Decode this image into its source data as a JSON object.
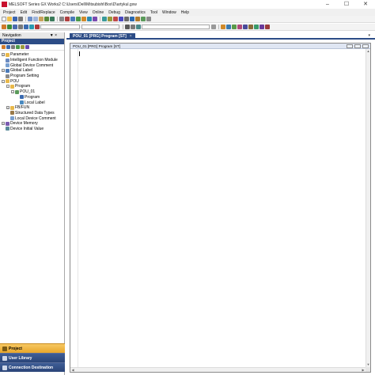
{
  "window": {
    "title": "MELSOFT Series GX Works2 C:\\Users\\Dell\\Mitsubishi\\Box\\D\\artykul.gxw",
    "minimize": "–",
    "maximize": "☐",
    "close": "✕"
  },
  "menu": [
    "Project",
    "Edit",
    "Find/Replace",
    "Compile",
    "View",
    "Online",
    "Debug",
    "Diagnostics",
    "Tool",
    "Window",
    "Help"
  ],
  "navigation": {
    "header": "Navigation",
    "pin": "▼ ×",
    "project_label": "Project",
    "tree": [
      {
        "label": "Parameter",
        "indent": 0,
        "expander": "+",
        "icon": "folder-icon"
      },
      {
        "label": "Intelligent Function Module",
        "indent": 0,
        "expander": "",
        "icon": "module-icon"
      },
      {
        "label": "Global Device Comment",
        "indent": 0,
        "expander": "",
        "icon": "comment-icon"
      },
      {
        "label": "Global Label",
        "indent": 0,
        "expander": "+",
        "icon": "label-icon"
      },
      {
        "label": "Program Setting",
        "indent": 0,
        "expander": "",
        "icon": "setting-icon"
      },
      {
        "label": "POU",
        "indent": 0,
        "expander": "−",
        "icon": "folder-icon"
      },
      {
        "label": "Program",
        "indent": 1,
        "expander": "−",
        "icon": "folder-icon"
      },
      {
        "label": "POU_01",
        "indent": 2,
        "expander": "−",
        "icon": "pou-icon"
      },
      {
        "label": "Program",
        "indent": 3,
        "expander": "",
        "icon": "program-icon"
      },
      {
        "label": "Local Label",
        "indent": 3,
        "expander": "",
        "icon": "local-label-icon"
      },
      {
        "label": "FB/FUN",
        "indent": 1,
        "expander": "+",
        "icon": "folder-icon"
      },
      {
        "label": "Structured Data Types",
        "indent": 1,
        "expander": "",
        "icon": "struct-icon"
      },
      {
        "label": "Local Device Comment",
        "indent": 1,
        "expander": "",
        "icon": "comment-icon"
      },
      {
        "label": "Device Memory",
        "indent": 0,
        "expander": "+",
        "icon": "memory-icon"
      },
      {
        "label": "Device Initial Value",
        "indent": 0,
        "expander": "",
        "icon": "initial-value-icon"
      }
    ],
    "bottom_tabs": [
      {
        "label": "Project",
        "active": true
      },
      {
        "label": "User Library",
        "active": false
      },
      {
        "label": "Connection Destination",
        "active": false
      }
    ]
  },
  "editor": {
    "tab_label": "POU_01 [PRG] Program [ST]",
    "tab_close": "×",
    "tab_dropdown": "▾",
    "document_title": "POU_01 [PRG] Program [ST]"
  },
  "colors": {
    "accent": "#2c4c86",
    "active_tab": "#e9a62a"
  }
}
